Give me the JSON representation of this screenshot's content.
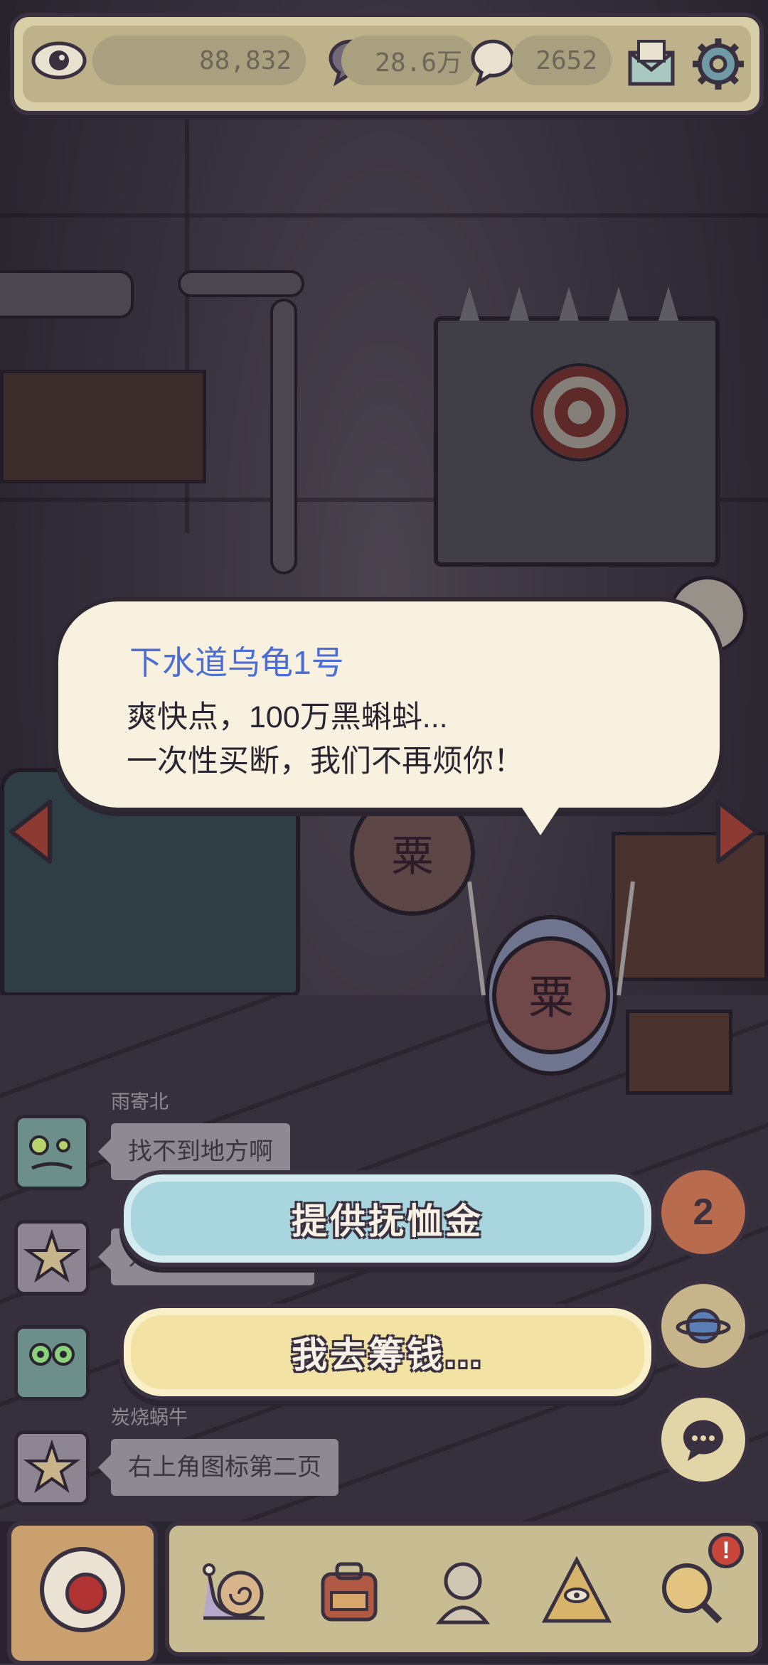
{
  "stats": {
    "views": "88,832",
    "messages": "28.6万",
    "comments": "2652"
  },
  "dialog": {
    "speaker": "下水道乌龟1号",
    "line1": "爽快点，100万黑蝌蚪...",
    "line2": "一次性买断，我们不再烦你！"
  },
  "chat": [
    {
      "name": "雨寄北",
      "message": "找不到地方啊"
    },
    {
      "name": "",
      "message": "开大前得注卡吧"
    },
    {
      "name": "",
      "message": ""
    },
    {
      "name": "炭烧蜗牛",
      "message": "右上角图标第二页"
    }
  ],
  "choices": {
    "primary": "提供抚恤金",
    "secondary": "我去筹钱..."
  },
  "side": {
    "badge_count": "2"
  },
  "bottom_nav": {
    "alert_mark": "!"
  },
  "colors": {
    "speaker": "#4b6dd4",
    "primary_button": "#a9d5de",
    "secondary_button": "#f2e3a5",
    "alert": "#c8463a"
  },
  "icons": [
    "eye-icon",
    "speech-bubble-icon",
    "comment-bubble-icon",
    "mail-icon",
    "gear-icon",
    "left-arrow-icon",
    "right-arrow-icon",
    "planet-icon",
    "chat-icon",
    "record-icon",
    "snail-icon",
    "backpack-icon",
    "bust-icon",
    "pyramid-eye-icon",
    "magnifier-icon"
  ]
}
